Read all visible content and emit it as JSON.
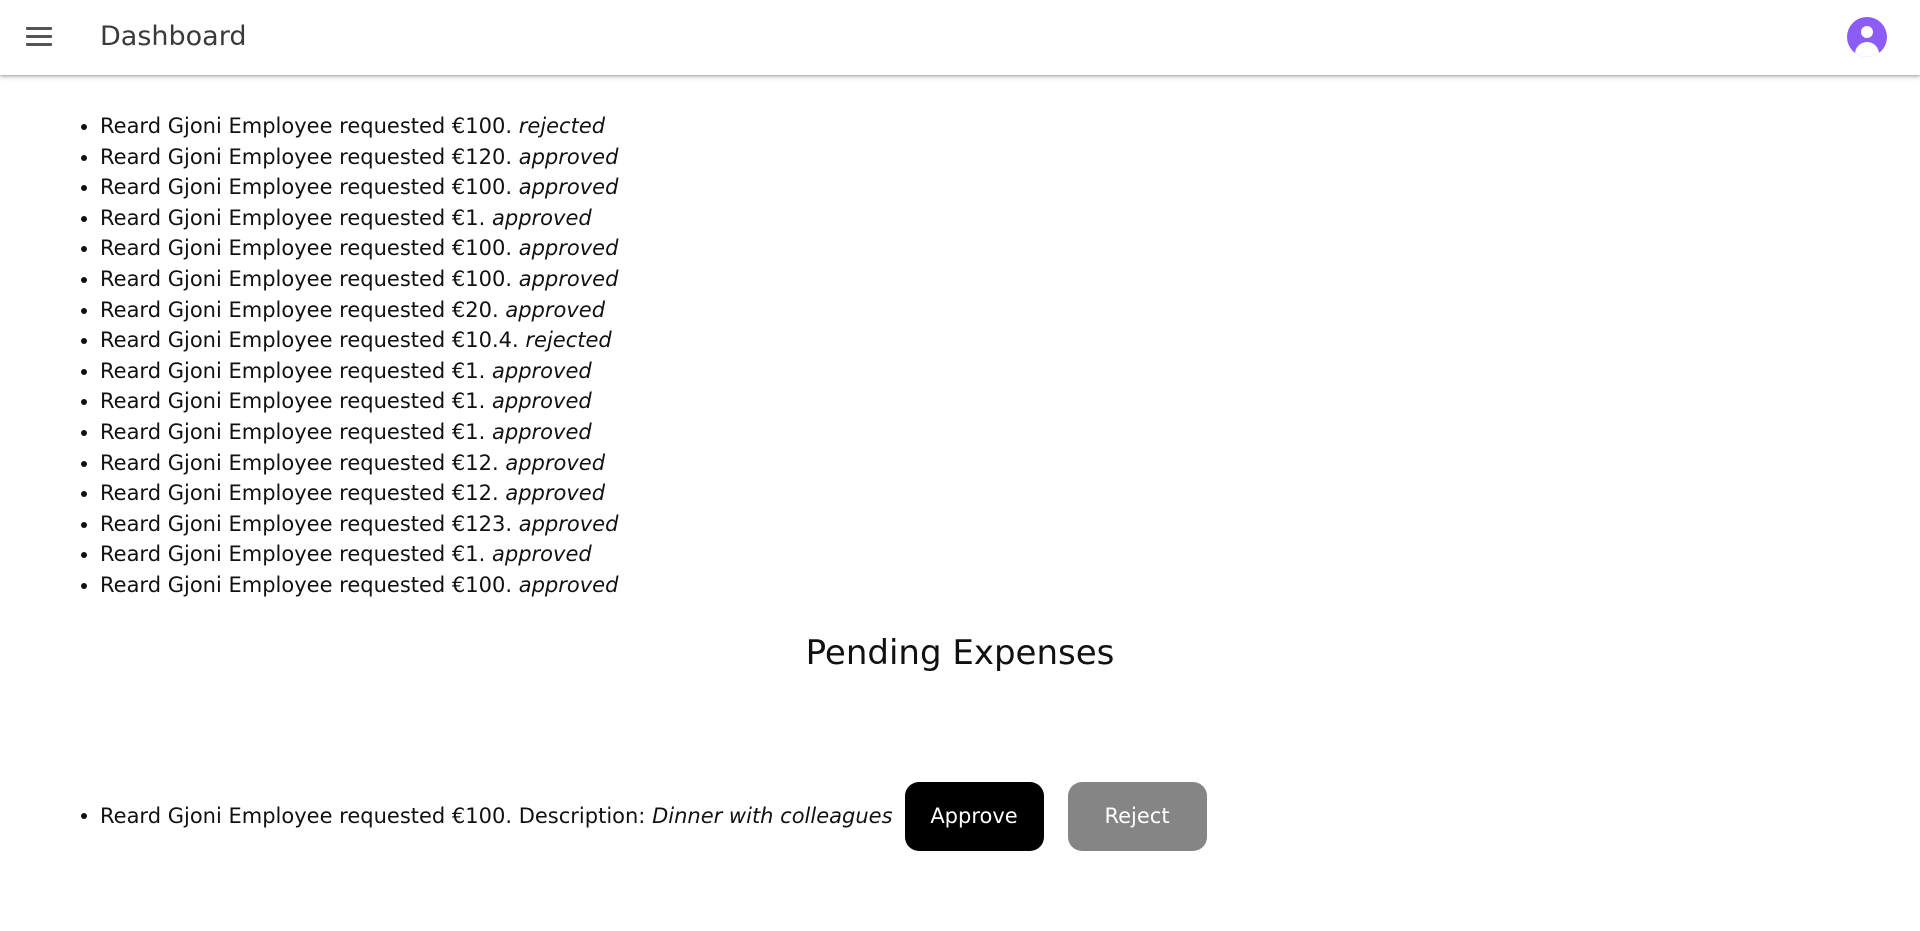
{
  "appbar": {
    "title": "Dashboard"
  },
  "history": {
    "items": [
      {
        "text": "Reard Gjoni Employee requested €100.",
        "status": "rejected"
      },
      {
        "text": "Reard Gjoni Employee requested €120.",
        "status": "approved"
      },
      {
        "text": "Reard Gjoni Employee requested €100.",
        "status": "approved"
      },
      {
        "text": "Reard Gjoni Employee requested €1.",
        "status": "approved"
      },
      {
        "text": "Reard Gjoni Employee requested €100.",
        "status": "approved"
      },
      {
        "text": "Reard Gjoni Employee requested €100.",
        "status": "approved"
      },
      {
        "text": "Reard Gjoni Employee requested €20.",
        "status": "approved"
      },
      {
        "text": "Reard Gjoni Employee requested €10.4.",
        "status": "rejected"
      },
      {
        "text": "Reard Gjoni Employee requested €1.",
        "status": "approved"
      },
      {
        "text": "Reard Gjoni Employee requested €1.",
        "status": "approved"
      },
      {
        "text": "Reard Gjoni Employee requested €1.",
        "status": "approved"
      },
      {
        "text": "Reard Gjoni Employee requested €12.",
        "status": "approved"
      },
      {
        "text": "Reard Gjoni Employee requested €12.",
        "status": "approved"
      },
      {
        "text": "Reard Gjoni Employee requested €123.",
        "status": "approved"
      },
      {
        "text": "Reard Gjoni Employee requested €1.",
        "status": "approved"
      },
      {
        "text": "Reard Gjoni Employee requested €100.",
        "status": "approved"
      }
    ]
  },
  "pending": {
    "title": "Pending Expenses",
    "items": [
      {
        "text": "Reard Gjoni Employee requested €100. Description:",
        "description": "Dinner with colleagues",
        "approve_label": "Approve",
        "reject_label": "Reject"
      }
    ]
  },
  "colors": {
    "avatar": "#8b5cf6",
    "approve_button": "#000000",
    "reject_button": "#858585"
  },
  "icons": {
    "menu": "menu-icon",
    "account": "account-circle-icon"
  }
}
